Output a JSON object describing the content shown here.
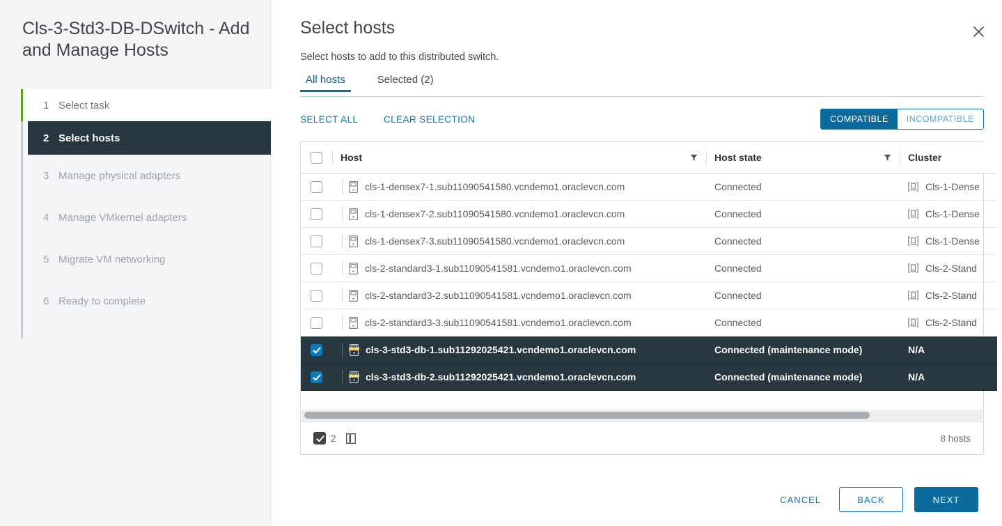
{
  "wizard": {
    "title": "Cls-3-Std3-DB-DSwitch - Add and Manage Hosts",
    "steps": [
      {
        "num": "1",
        "label": "Select task",
        "state": "done"
      },
      {
        "num": "2",
        "label": "Select hosts",
        "state": "active"
      },
      {
        "num": "3",
        "label": "Manage physical adapters",
        "state": "pending"
      },
      {
        "num": "4",
        "label": "Manage VMkernel adapters",
        "state": "pending"
      },
      {
        "num": "5",
        "label": "Migrate VM networking",
        "state": "pending"
      },
      {
        "num": "6",
        "label": "Ready to complete",
        "state": "pending"
      }
    ]
  },
  "page": {
    "title": "Select hosts",
    "subtitle": "Select hosts to add to this distributed switch.",
    "close_icon": "close-icon"
  },
  "tabs": [
    {
      "label": "All hosts",
      "active": true
    },
    {
      "label": "Selected (2)",
      "active": false
    }
  ],
  "toolbar": {
    "select_all": "SELECT ALL",
    "clear_selection": "CLEAR SELECTION",
    "compatible": "COMPATIBLE",
    "incompatible": "INCOMPATIBLE",
    "compatible_active": true
  },
  "table": {
    "columns": [
      "Host",
      "Host state",
      "Cluster"
    ],
    "header_checkbox_checked": false,
    "rows": [
      {
        "checked": false,
        "host_icon": "host-icon",
        "host": "cls-1-densex7-1.sub11090541580.vcndemo1.oraclevcn.com",
        "state": "Connected",
        "cluster_icon": "cluster-icon",
        "cluster": "Cls-1-Dense"
      },
      {
        "checked": false,
        "host_icon": "host-icon",
        "host": "cls-1-densex7-2.sub11090541580.vcndemo1.oraclevcn.com",
        "state": "Connected",
        "cluster_icon": "cluster-icon",
        "cluster": "Cls-1-Dense"
      },
      {
        "checked": false,
        "host_icon": "host-icon",
        "host": "cls-1-densex7-3.sub11090541580.vcndemo1.oraclevcn.com",
        "state": "Connected",
        "cluster_icon": "cluster-icon",
        "cluster": "Cls-1-Dense"
      },
      {
        "checked": false,
        "host_icon": "host-icon",
        "host": "cls-2-standard3-1.sub11090541581.vcndemo1.oraclevcn.com",
        "state": "Connected",
        "cluster_icon": "cluster-icon",
        "cluster": "Cls-2-Stand"
      },
      {
        "checked": false,
        "host_icon": "host-icon",
        "host": "cls-2-standard3-2.sub11090541581.vcndemo1.oraclevcn.com",
        "state": "Connected",
        "cluster_icon": "cluster-icon",
        "cluster": "Cls-2-Stand"
      },
      {
        "checked": false,
        "host_icon": "host-icon",
        "host": "cls-2-standard3-3.sub11090541581.vcndemo1.oraclevcn.com",
        "state": "Connected",
        "cluster_icon": "cluster-icon",
        "cluster": "Cls-2-Stand"
      },
      {
        "checked": true,
        "host_icon": "host-maintenance-mode-icon",
        "host": "cls-3-std3-db-1.sub11292025421.vcndemo1.oraclevcn.com",
        "state": "Connected (maintenance mode)",
        "cluster_icon": "",
        "cluster": "N/A"
      },
      {
        "checked": true,
        "host_icon": "host-maintenance-mode-icon",
        "host": "cls-3-std3-db-2.sub11292025421.vcndemo1.oraclevcn.com",
        "state": "Connected (maintenance mode)",
        "cluster_icon": "",
        "cluster": "N/A"
      }
    ],
    "footer": {
      "selected_count": "2",
      "columns_icon": "columns-icon",
      "total": "8 hosts"
    }
  },
  "actions": {
    "cancel": "CANCEL",
    "back": "BACK",
    "next": "NEXT"
  },
  "colors": {
    "accent": "#0d6a9c",
    "link": "#0b77b0",
    "selected_row_bg": "#27373f",
    "step_done_rail": "#5aa220",
    "checkbox_checked": "#0b7cbb",
    "maintenance_stripe": "#f5b921"
  }
}
